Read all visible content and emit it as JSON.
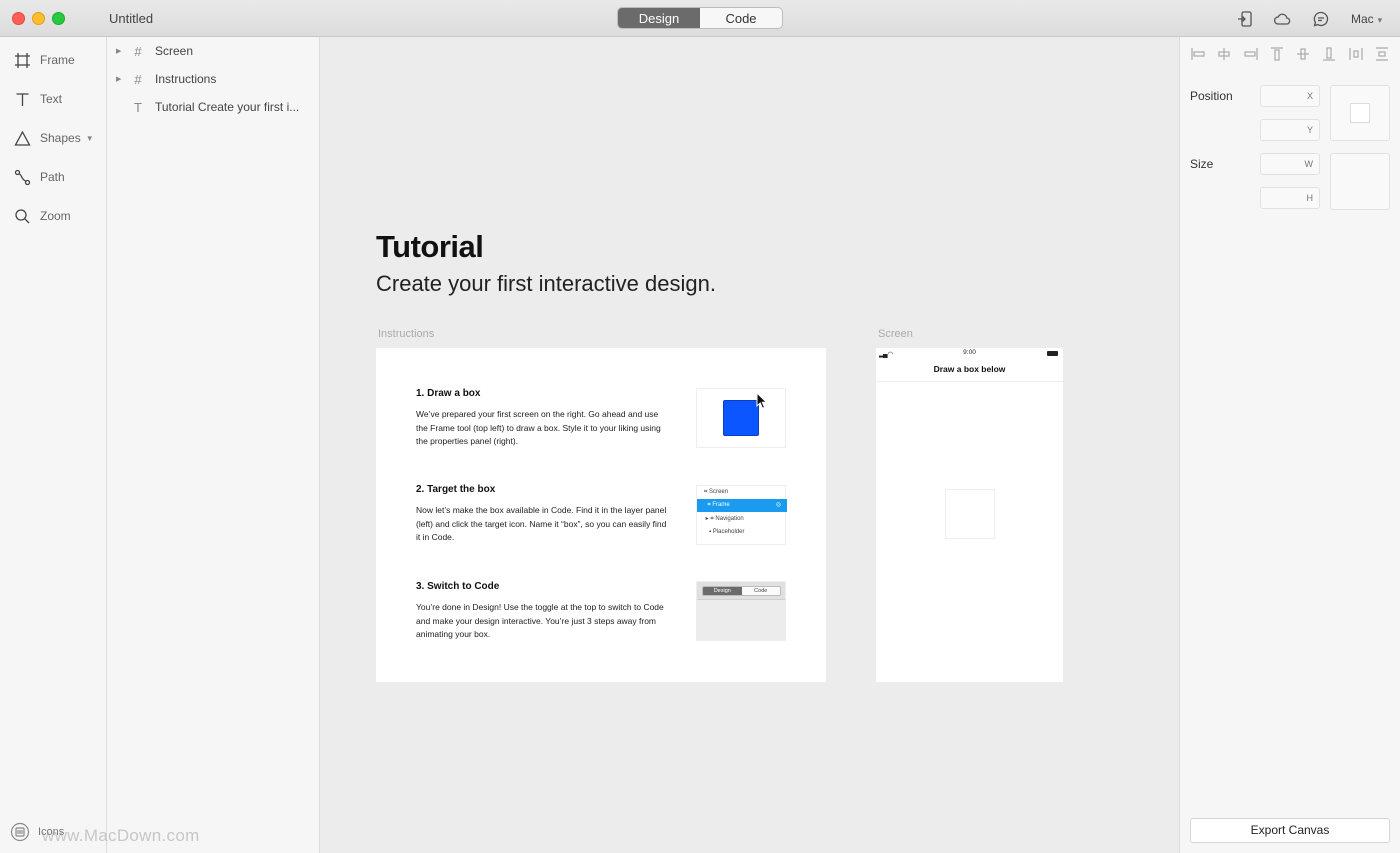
{
  "window": {
    "title": "Untitled",
    "modes": [
      "Design",
      "Code"
    ],
    "active_mode": "Design",
    "user_menu": "Mac"
  },
  "tools": [
    {
      "label": "Frame",
      "icon": "frame-icon"
    },
    {
      "label": "Text",
      "icon": "text-icon"
    },
    {
      "label": "Shapes",
      "icon": "triangle-icon"
    },
    {
      "label": "Path",
      "icon": "path-icon"
    },
    {
      "label": "Zoom",
      "icon": "magnifier-icon"
    }
  ],
  "layers": [
    {
      "label": "Screen",
      "icon": "frame-hash-icon"
    },
    {
      "label": "Instructions",
      "icon": "frame-hash-icon"
    },
    {
      "label": "Tutorial Create your first i...",
      "icon": "text-icon"
    }
  ],
  "canvas": {
    "title": "Tutorial",
    "subtitle": "Create your first interactive design.",
    "instructions_label": "Instructions",
    "screen_label": "Screen",
    "steps": [
      {
        "heading": "1. Draw a box",
        "body": "We’ve prepared your first screen on the right. Go ahead and use the Frame tool (top left) to draw a box. Style it to your liking using the properties panel (right)."
      },
      {
        "heading": "2. Target the box",
        "body": "Now let’s make the box available in Code. Find it in the layer panel (left) and click the target icon. Name it “box”, so you can easily find it in Code."
      },
      {
        "heading": "3. Switch to Code",
        "body": "You’re done in Design! Use the toggle at the top to switch to Code and make your design interactive. You’re just 3 steps away from animating your box."
      }
    ],
    "mini_layers": [
      "Screen",
      "Frame",
      "Navigation",
      "Placeholder"
    ],
    "mini_toggle": [
      "Design",
      "Code"
    ],
    "screen": {
      "time": "9:00",
      "nav_title": "Draw a box below"
    }
  },
  "properties": {
    "position_label": "Position",
    "size_label": "Size",
    "x_placeholder": "X",
    "y_placeholder": "Y",
    "w_placeholder": "W",
    "h_placeholder": "H",
    "export_label": "Export Canvas"
  },
  "footer": {
    "icons_label": "Icons",
    "watermark": "www.MacDown.com"
  },
  "colors": {
    "accent_blue": "#0b56ff",
    "selection_blue": "#1a9bf0",
    "toggle_active": "#6b6b6b"
  }
}
